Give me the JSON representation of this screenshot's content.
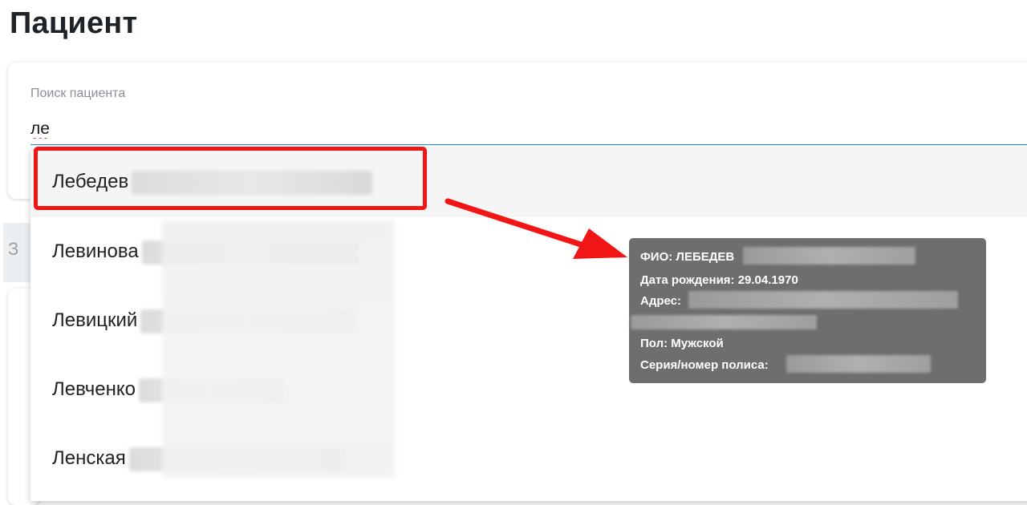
{
  "page": {
    "title": "Пациент"
  },
  "search": {
    "label": "Поиск пациента",
    "value": "ле",
    "background_partial_text": "З"
  },
  "dropdown": {
    "items": [
      {
        "surname": "Лебедев",
        "highlighted": true
      },
      {
        "surname": "Левинова",
        "highlighted": false
      },
      {
        "surname": "Левицкий",
        "highlighted": false
      },
      {
        "surname": "Левченко",
        "highlighted": false
      },
      {
        "surname": "Ленская",
        "highlighted": false
      }
    ]
  },
  "tooltip": {
    "fio_label": "ФИО: ЛЕБЕДЕВ",
    "birth_label": "Дата рождения: 29.04.1970",
    "address_label": "Адрес:",
    "gender_label": "Пол: Мужской",
    "policy_label": "Серия/номер полиса:"
  },
  "colors": {
    "highlight": "#f21515",
    "arrow": "#f21515",
    "tooltip_bg": "#6e6e6e",
    "input_underline": "#1e88e5"
  },
  "icons": {
    "annotation_arrow": "arrow-right-icon"
  }
}
